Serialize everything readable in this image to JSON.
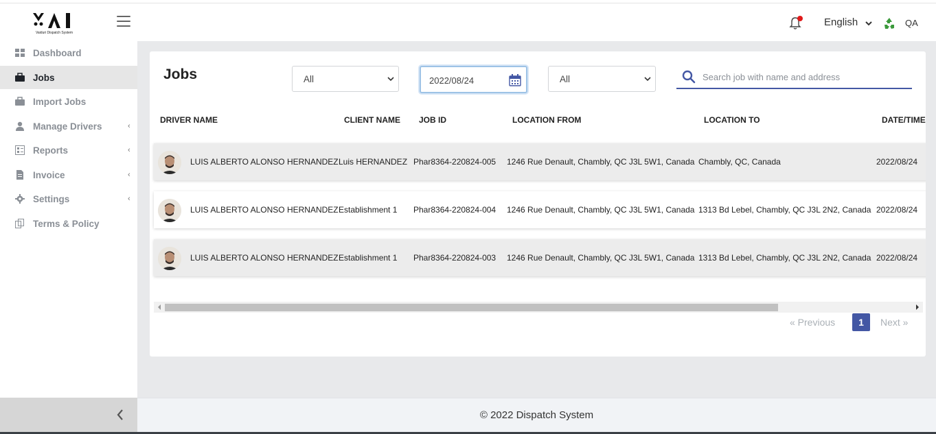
{
  "app": {
    "logo_subtitle": "Vaiduri Dispatch System",
    "user": "QA"
  },
  "header": {
    "language": "English"
  },
  "sidebar": {
    "items": [
      {
        "label": "Dashboard",
        "icon": "grid-icon",
        "active": false,
        "submenu": false
      },
      {
        "label": "Jobs",
        "icon": "briefcase-icon",
        "active": true,
        "submenu": false
      },
      {
        "label": "Import Jobs",
        "icon": "briefcase-icon",
        "active": false,
        "submenu": false
      },
      {
        "label": "Manage Drivers",
        "icon": "user-icon",
        "active": false,
        "submenu": true
      },
      {
        "label": "Reports",
        "icon": "report-icon",
        "active": false,
        "submenu": true
      },
      {
        "label": "Invoice",
        "icon": "document-icon",
        "active": false,
        "submenu": true
      },
      {
        "label": "Settings",
        "icon": "gear-icon",
        "active": false,
        "submenu": true
      },
      {
        "label": "Terms & Policy",
        "icon": "copy-icon",
        "active": false,
        "submenu": false
      }
    ]
  },
  "jobs": {
    "title": "Jobs",
    "filter1": "All",
    "date": "2022/08/24",
    "filter2": "All",
    "search_placeholder": "Search job with name and address",
    "columns": [
      "DRIVER NAME",
      "CLIENT NAME",
      "JOB ID",
      "LOCATION FROM",
      "LOCATION TO",
      "DATE/TIME"
    ],
    "rows": [
      {
        "driver": "LUIS ALBERTO ALONSO HERNANDEZ",
        "client": "Luis HERNANDEZ",
        "job_id": "Phar8364-220824-005",
        "from": "1246 Rue Denault, Chambly, QC J3L 5W1, Canada",
        "to": "Chambly, QC, Canada",
        "date": "2022/08/24"
      },
      {
        "driver": "LUIS ALBERTO ALONSO HERNANDEZ",
        "client": "Establishment 1",
        "job_id": "Phar8364-220824-004",
        "from": "1246 Rue Denault, Chambly, QC J3L 5W1, Canada",
        "to": "1313 Bd Lebel, Chambly, QC J3L 2N2, Canada",
        "date": "2022/08/24"
      },
      {
        "driver": "LUIS ALBERTO ALONSO HERNANDEZ",
        "client": "Establishment 1",
        "job_id": "Phar8364-220824-003",
        "from": "1246 Rue Denault, Chambly, QC J3L 5W1, Canada",
        "to": "1313 Bd Lebel, Chambly, QC J3L 2N2, Canada",
        "date": "2022/08/24"
      }
    ],
    "pagination": {
      "prev": "« Previous",
      "current": "1",
      "next": "Next »"
    }
  },
  "footer": {
    "text": "© 2022 Dispatch System"
  },
  "colors": {
    "accent": "#4357a4",
    "notification": "#e01919",
    "recycle": "#3b9a3b"
  }
}
